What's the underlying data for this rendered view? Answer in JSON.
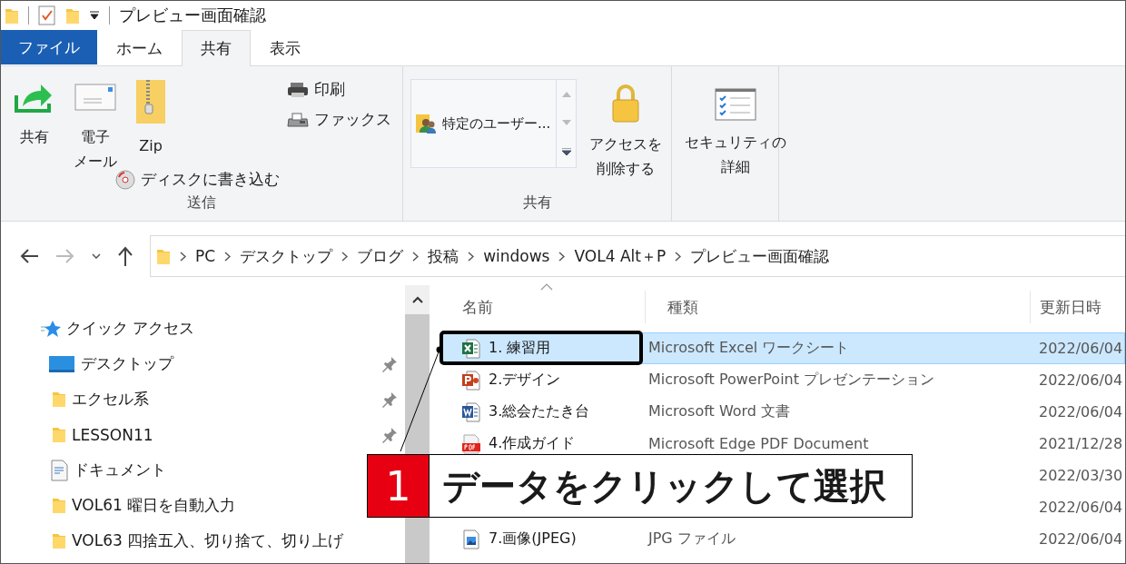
{
  "window": {
    "title": "プレビュー画面確認"
  },
  "ribbon_tabs": [
    {
      "label": "ファイル",
      "kind": "file",
      "selected": false
    },
    {
      "label": "ホーム",
      "kind": "tab",
      "selected": false
    },
    {
      "label": "共有",
      "kind": "tab",
      "selected": true
    },
    {
      "label": "表示",
      "kind": "tab",
      "selected": false
    }
  ],
  "ribbon": {
    "send_group": {
      "label": "送信",
      "share": "共有",
      "email": [
        "電子",
        "メール"
      ],
      "zip": "Zip",
      "burn": "ディスクに書き込む",
      "print": "印刷",
      "fax": "ファックス"
    },
    "share_group": {
      "label": "共有",
      "gallery_item": "特定のユーザー...",
      "remove_access": [
        "アクセスを",
        "削除する"
      ]
    },
    "security": [
      "セキュリティの",
      "詳細"
    ]
  },
  "address_bar": {
    "breadcrumbs": [
      "PC",
      "デスクトップ",
      "ブログ",
      "投稿",
      "windows",
      "VOL4 Alt＋P",
      "プレビュー画面確認"
    ]
  },
  "navigation": [
    {
      "label": "クイック アクセス",
      "kind": "quick_access",
      "pinned": false
    },
    {
      "label": "デスクトップ",
      "kind": "desktop",
      "pinned": true
    },
    {
      "label": "エクセル系",
      "kind": "folder",
      "pinned": true
    },
    {
      "label": "LESSON11",
      "kind": "folder",
      "pinned": true
    },
    {
      "label": "ドキュメント",
      "kind": "documents"
    },
    {
      "label": "VOL61 曜日を自動入力",
      "kind": "folder"
    },
    {
      "label": "VOL63 四捨五入、切り捨て、切り上げ",
      "kind": "folder",
      "pinned": false
    }
  ],
  "file_list": {
    "columns": [
      "名前",
      "種類",
      "更新日時"
    ],
    "rows": [
      {
        "name": "1. 練習用",
        "type": "Microsoft Excel ワークシート",
        "date": "2022/06/04",
        "kind": "excel",
        "selected": true
      },
      {
        "name": "2.デザイン",
        "type": "Microsoft PowerPoint プレゼンテーション",
        "date": "2022/06/04",
        "kind": "powerpoint",
        "selected": false
      },
      {
        "name": "3.総会たたき台",
        "type": "Microsoft Word 文書",
        "date": "2022/06/04",
        "kind": "word",
        "selected": false
      },
      {
        "name": "4.作成ガイド",
        "type": "Microsoft Edge PDF Document",
        "date": "2021/12/28",
        "kind": "pdf",
        "selected": false
      },
      {
        "date": "2022/03/30",
        "selected": false
      },
      {
        "date": "2022/06/04",
        "selected": false
      },
      {
        "name": "7.画像(JPEG)",
        "type": "JPG ファイル",
        "date": "2022/06/04",
        "kind": "image",
        "selected": false
      }
    ]
  },
  "annotation": {
    "number": "1",
    "text": "データをクリックして選択"
  }
}
